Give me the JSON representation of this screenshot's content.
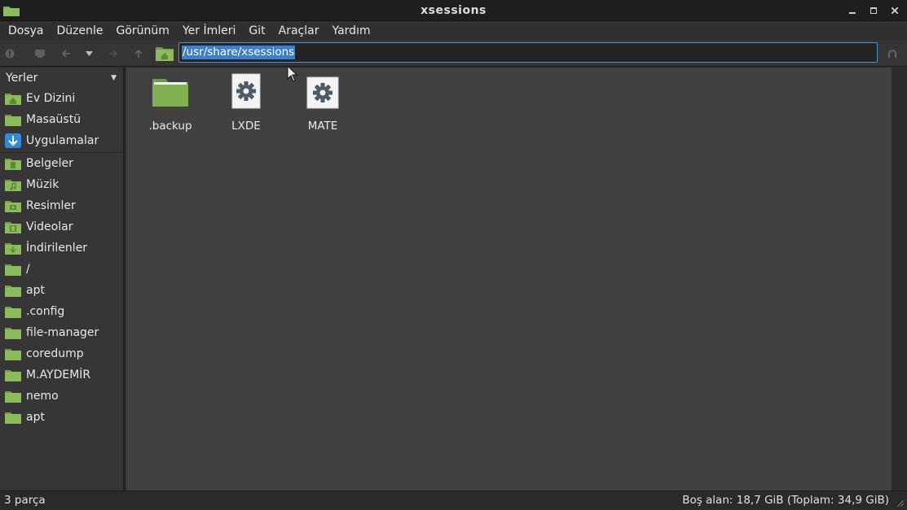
{
  "window": {
    "title": "xsessions"
  },
  "menu": [
    "Dosya",
    "Düzenle",
    "Görünüm",
    "Yer İmleri",
    "Git",
    "Araçlar",
    "Yardım"
  ],
  "path": {
    "value": "/usr/share/xsessions"
  },
  "sidebar": {
    "header": "Yerler",
    "items": [
      {
        "label": "Ev Dizini",
        "icon": "home-folder-icon"
      },
      {
        "label": "Masaüstü",
        "icon": "desktop-folder-icon"
      },
      {
        "label": "Uygulamalar",
        "icon": "applications-icon"
      },
      {
        "label": "Belgeler",
        "icon": "documents-folder-icon"
      },
      {
        "label": "Müzik",
        "icon": "music-folder-icon"
      },
      {
        "label": "Resimler",
        "icon": "pictures-folder-icon"
      },
      {
        "label": "Videolar",
        "icon": "videos-folder-icon"
      },
      {
        "label": "İndirilenler",
        "icon": "downloads-folder-icon"
      },
      {
        "label": "/",
        "icon": "folder-icon"
      },
      {
        "label": "apt",
        "icon": "folder-icon"
      },
      {
        "label": ".config",
        "icon": "folder-icon"
      },
      {
        "label": "file-manager",
        "icon": "folder-icon"
      },
      {
        "label": "coredump",
        "icon": "folder-icon"
      },
      {
        "label": "M.AYDEMİR",
        "icon": "folder-icon"
      },
      {
        "label": "nemo",
        "icon": "folder-icon"
      },
      {
        "label": "apt",
        "icon": "folder-icon"
      }
    ]
  },
  "files": [
    {
      "label": ".backup",
      "icon": "folder-icon"
    },
    {
      "label": "LXDE",
      "icon": "gear-file-icon"
    },
    {
      "label": "MATE",
      "icon": "gear-file-icon"
    }
  ],
  "status": {
    "count": "3 parça",
    "space": "Boş alan: 18,7 GiB (Toplam: 34,9 GiB)"
  },
  "colors": {
    "folder": "#7fae4f",
    "selection": "#3d7fc9",
    "accent": "#4a90d9"
  }
}
